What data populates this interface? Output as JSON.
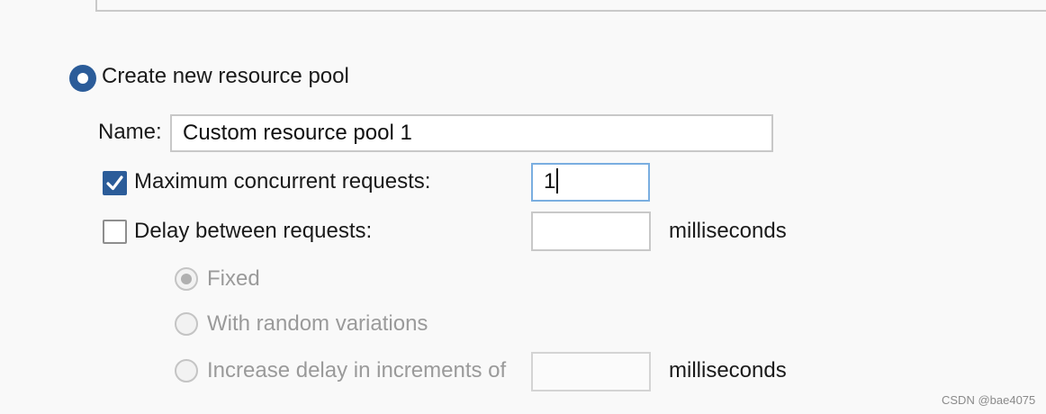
{
  "pool_option": {
    "label": "Create new resource pool",
    "selected": true
  },
  "name_field": {
    "label": "Name:",
    "value": "Custom resource pool 1"
  },
  "max_concurrent": {
    "label": "Maximum concurrent requests:",
    "checked": true,
    "value": "1"
  },
  "delay": {
    "label": "Delay between requests:",
    "checked": false,
    "value": "",
    "unit": "milliseconds",
    "options": [
      {
        "label": "Fixed",
        "selected": true,
        "enabled": false
      },
      {
        "label": "With random variations",
        "selected": false,
        "enabled": false
      },
      {
        "label": "Increase delay in increments of",
        "selected": false,
        "enabled": false
      }
    ],
    "increment_value": "",
    "increment_unit": "milliseconds"
  },
  "watermark": "CSDN @bae4075",
  "colors": {
    "accent": "#2b5c99",
    "focus_border": "#7aaee0",
    "disabled_text": "#9a9a9a",
    "background": "#f9f9f9"
  }
}
